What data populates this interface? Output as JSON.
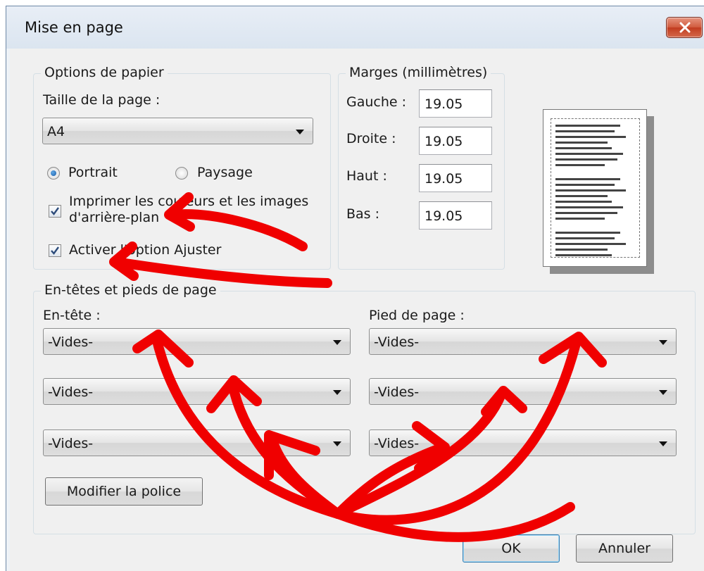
{
  "window": {
    "title": "Mise en page"
  },
  "paper_options": {
    "legend": "Options de papier",
    "page_size_label": "Taille de la page :",
    "page_size_value": "A4",
    "portrait_label": "Portrait",
    "landscape_label": "Paysage",
    "orientation_selected": "Portrait",
    "print_background_line1": "Imprimer les couleurs et les images",
    "print_background_line2": "d'arrière-plan",
    "print_background_checked": true,
    "shrink_to_fit_label": "Activer l'option Ajuster",
    "shrink_to_fit_checked": true
  },
  "margins": {
    "legend": "Marges (millimètres)",
    "left_label": "Gauche :",
    "left_value": "19.05",
    "right_label": "Droite :",
    "right_value": "19.05",
    "top_label": "Haut :",
    "top_value": "19.05",
    "bottom_label": "Bas :",
    "bottom_value": "19.05"
  },
  "headers_footers": {
    "legend": "En-têtes et pieds de page",
    "header_label": "En-tête :",
    "footer_label": "Pied de page :",
    "header_values": [
      "-Vides-",
      "-Vides-",
      "-Vides-"
    ],
    "footer_values": [
      "-Vides-",
      "-Vides-",
      "-Vides-"
    ],
    "font_button": "Modifier la police"
  },
  "buttons": {
    "ok": "OK",
    "cancel": "Annuler"
  },
  "annotation": {
    "color": "#f00000"
  }
}
